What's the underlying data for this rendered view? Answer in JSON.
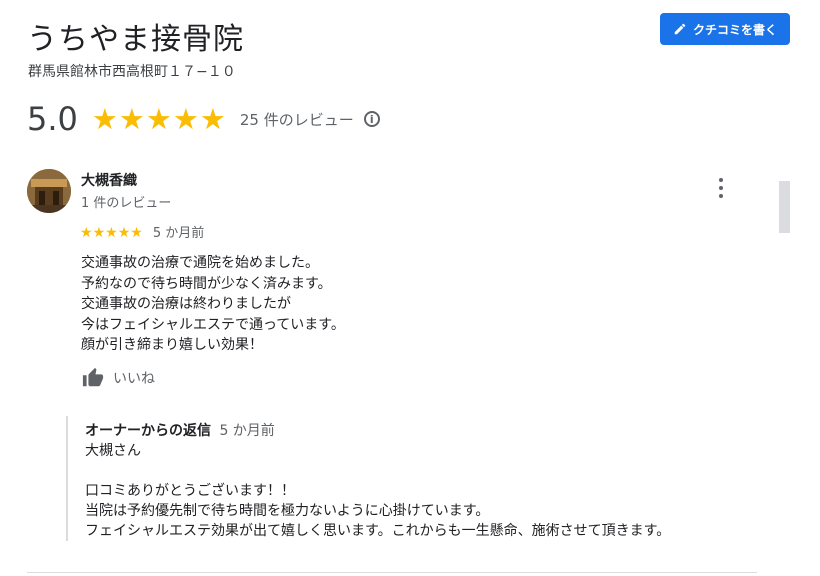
{
  "place": {
    "name": "うちやま接骨院",
    "address": "群馬県館林市西高根町１７−１０"
  },
  "write_review_button": {
    "label": "クチコミを書く",
    "icon": "pencil-icon"
  },
  "summary": {
    "rating": "5.0",
    "stars": 5,
    "review_count_label": "25 件のレビュー",
    "info_icon": "info-icon"
  },
  "review": {
    "author": "大槻香織",
    "author_meta": "1 件のレビュー",
    "stars": 5,
    "time": "5 か月前",
    "lines": [
      "交通事故の治療で通院を始めました。",
      "予約なので待ち時間が少なく済みます。",
      "交通事故の治療は終わりましたが",
      "今はフェイシャルエステで通っています。",
      "顔が引き締まり嬉しい効果！"
    ],
    "like_label": "いいね"
  },
  "owner_reply": {
    "label": "オーナーからの返信",
    "time": "5 か月前",
    "lines": [
      "大槻さん",
      "",
      "口コミありがとうございます！！",
      "当院は予約優先制で待ち時間を極力ないように心掛けています。",
      "フェイシャルエステ効果が出て嬉しく思います。これからも一生懸命、施術させて頂きます。"
    ]
  },
  "colors": {
    "star": "#fbbc04",
    "button": "#1a73e8",
    "muted_text": "#5f6368"
  }
}
